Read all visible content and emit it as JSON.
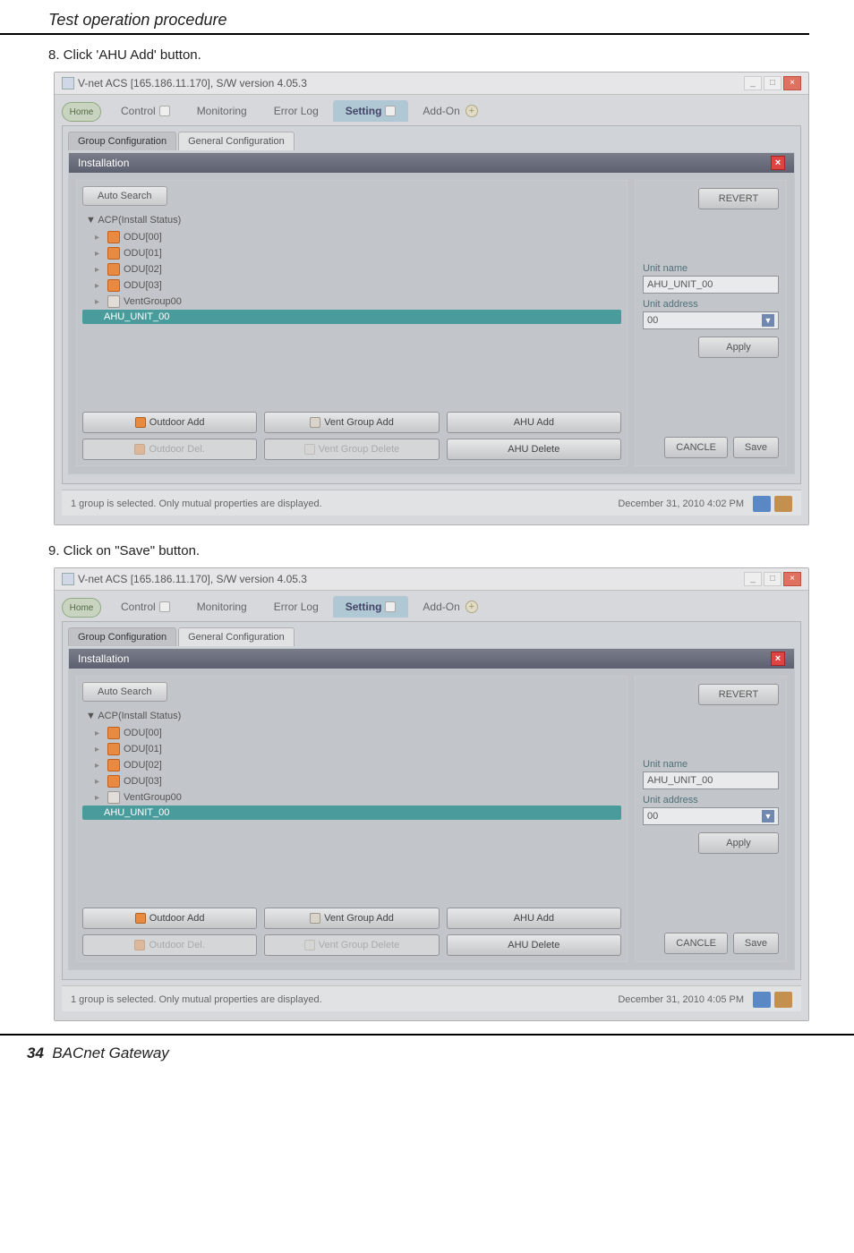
{
  "page_section_title": "Test operation procedure",
  "step8_text": "8. Click 'AHU Add' button.",
  "step9_text": "9. Click on \"Save\" button.",
  "page_footer_number": "34",
  "page_footer_text": "BACnet Gateway",
  "window1": {
    "title": "V-net ACS [165.186.11.170],   S/W version 4.05.3",
    "nav": {
      "home": "Home",
      "control": "Control",
      "monitoring": "Monitoring",
      "errorlog": "Error Log",
      "setting": "Setting",
      "addon": "Add-On"
    },
    "sub_tabs": {
      "group_conf": "Group Configuration",
      "general_conf": "General Configuration"
    },
    "panel_title": "Installation",
    "auto_search": "Auto Search",
    "tree_root": "▼ ACP(Install Status)",
    "tree": [
      {
        "label": "ODU[00]"
      },
      {
        "label": "ODU[01]"
      },
      {
        "label": "ODU[02]"
      },
      {
        "label": "ODU[03]"
      },
      {
        "label": "VentGroup00",
        "vent": true
      },
      {
        "label": "AHU_UNIT_00",
        "selected": true
      }
    ],
    "actions": {
      "outdoor_add": "Outdoor Add",
      "vent_group_add": "Vent Group Add",
      "ahu_add": "AHU Add",
      "outdoor_del": "Outdoor Del.",
      "vent_group_del": "Vent Group Delete",
      "ahu_delete": "AHU Delete"
    },
    "right": {
      "revert": "REVERT",
      "unit_name_label": "Unit name",
      "unit_name_value": "AHU_UNIT_00",
      "unit_addr_label": "Unit address",
      "unit_addr_value": "00",
      "apply": "Apply",
      "cancle": "CANCLE",
      "save": "Save"
    },
    "status": {
      "left": "1 group is selected. Only mutual properties are displayed.",
      "right": "December 31, 2010  4:02 PM"
    }
  },
  "window2": {
    "title": "V-net ACS [165.186.11.170],   S/W version 4.05.3",
    "nav": {
      "home": "Home",
      "control": "Control",
      "monitoring": "Monitoring",
      "errorlog": "Error Log",
      "setting": "Setting",
      "addon": "Add-On"
    },
    "sub_tabs": {
      "group_conf": "Group Configuration",
      "general_conf": "General Configuration"
    },
    "panel_title": "Installation",
    "auto_search": "Auto Search",
    "tree_root": "▼ ACP(Install Status)",
    "tree": [
      {
        "label": "ODU[00]"
      },
      {
        "label": "ODU[01]"
      },
      {
        "label": "ODU[02]"
      },
      {
        "label": "ODU[03]"
      },
      {
        "label": "VentGroup00",
        "vent": true
      },
      {
        "label": "AHU_UNIT_00",
        "selected": true
      }
    ],
    "actions": {
      "outdoor_add": "Outdoor Add",
      "vent_group_add": "Vent Group Add",
      "ahu_add": "AHU Add",
      "outdoor_del": "Outdoor Del.",
      "vent_group_del": "Vent Group Delete",
      "ahu_delete": "AHU Delete"
    },
    "right": {
      "revert": "REVERT",
      "unit_name_label": "Unit name",
      "unit_name_value": "AHU_UNIT_00",
      "unit_addr_label": "Unit address",
      "unit_addr_value": "00",
      "apply": "Apply",
      "cancle": "CANCLE",
      "save": "Save"
    },
    "status": {
      "left": "1 group is selected. Only mutual properties are displayed.",
      "right": "December 31, 2010  4:05 PM"
    }
  }
}
